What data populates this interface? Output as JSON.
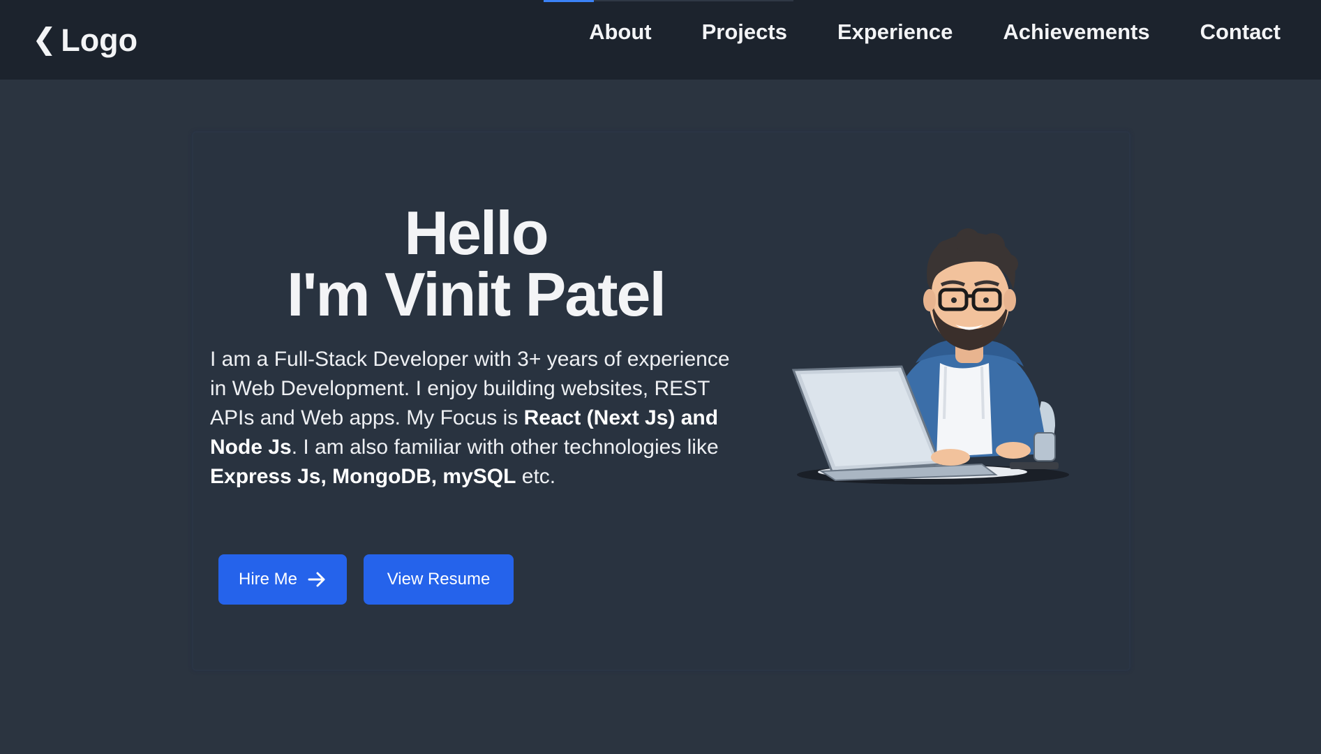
{
  "nav": {
    "logo_icon": "chevron-left-icon",
    "logo_text": "Logo",
    "links": [
      "About",
      "Projects",
      "Experience",
      "Achievements",
      "Contact"
    ]
  },
  "hero": {
    "title_line1": "Hello",
    "title_line2": "I'm Vinit Patel",
    "desc_1": "I am a Full-Stack Developer with 3+ years of experience in Web Development. I enjoy building websites, REST APIs and Web apps. My Focus is ",
    "desc_bold_1": "React (Next Js) and Node Js",
    "desc_2": ". I am also familiar with other technologies like ",
    "desc_bold_2": "Express Js, MongoDB, mySQL",
    "desc_3": " etc.",
    "hire_label": "Hire Me",
    "resume_label": "View Resume"
  },
  "colors": {
    "background": "#2b3440",
    "navbar": "#1c232d",
    "accent": "#2563eb",
    "text": "#f3f4f6"
  }
}
